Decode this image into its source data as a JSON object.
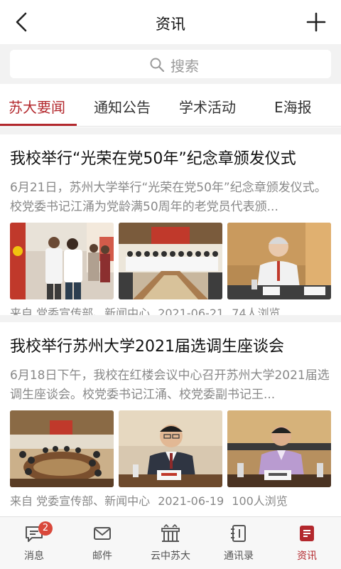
{
  "header": {
    "title": "资讯",
    "back_icon": "chevron-left-icon",
    "add_icon": "plus-icon"
  },
  "search": {
    "placeholder": "搜索",
    "icon": "search-icon"
  },
  "tabs": [
    {
      "label": "苏大要闻",
      "active": true
    },
    {
      "label": "通知公告",
      "active": false
    },
    {
      "label": "学术活动",
      "active": false
    },
    {
      "label": "E海报",
      "active": false
    }
  ],
  "articles": [
    {
      "title": "我校举行“光荣在党50年”纪念章颁发仪式",
      "summary": "6月21日，苏州大学举行“光荣在党50年”纪念章颁发仪式。校党委书记江涌为党龄满50周年的老党员代表颁...",
      "source": "来自 党委宣传部、新闻中心",
      "date": "2021-06-21",
      "views": "74人浏览"
    },
    {
      "title": "我校举行苏州大学2021届选调生座谈会",
      "summary": "6月18日下午，我校在红楼会议中心召开苏州大学2021届选调生座谈会。校党委书记江涌、校党委副书记王...",
      "source": "来自 党委宣传部、新闻中心",
      "date": "2021-06-19",
      "views": "100人浏览"
    }
  ],
  "bottom_nav": [
    {
      "label": "消息",
      "icon": "message-icon",
      "badge": "2",
      "active": false
    },
    {
      "label": "邮件",
      "icon": "mail-icon",
      "active": false
    },
    {
      "label": "云中苏大",
      "icon": "campus-gate-icon",
      "active": false
    },
    {
      "label": "通讯录",
      "icon": "contacts-icon",
      "active": false
    },
    {
      "label": "资讯",
      "icon": "news-icon",
      "active": true
    }
  ],
  "colors": {
    "accent": "#b3282d",
    "badge": "#d9483b",
    "background_gray": "#f2f2f2"
  }
}
